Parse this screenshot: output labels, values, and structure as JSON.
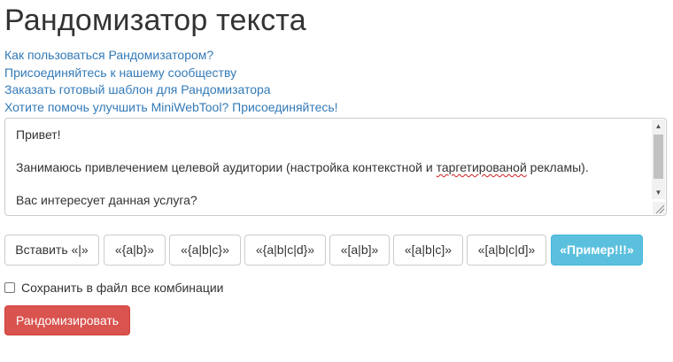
{
  "page": {
    "title": "Рандомизатор текста"
  },
  "links": [
    {
      "label": "Как пользоваться Рандомизатором?"
    },
    {
      "label": "Присоединяйтесь к нашему сообществу"
    },
    {
      "label": "Заказать готовый шаблон для Рандомизатора"
    },
    {
      "label": "Хотите помочь улучшить MiniWebTool? Присоединяйтесь!"
    }
  ],
  "editor": {
    "line1": "Привет!",
    "line2": "",
    "line3_before": "Занимаюсь привлечением целевой аудитории (настройка контекстной и ",
    "line3_misspelled": "таргетированой",
    "line3_after": " рекламы).",
    "line4": "",
    "line5": "Вас интересует данная услуга?"
  },
  "toolbar": {
    "buttons": [
      {
        "label": "Вставить «|»"
      },
      {
        "label": "«{a|b}»"
      },
      {
        "label": "«{a|b|c}»"
      },
      {
        "label": "«{a|b|c|d}»"
      },
      {
        "label": "«[a|b]»"
      },
      {
        "label": "«[a|b|c]»"
      },
      {
        "label": "«[a|b|c|d]»"
      },
      {
        "label": "«Пример!!!»"
      }
    ]
  },
  "options": {
    "save_combinations_label": "Сохранить в файл все комбинации",
    "save_combinations_checked": false
  },
  "actions": {
    "randomize_label": "Рандомизировать"
  },
  "colors": {
    "link": "#337ab7",
    "info": "#5bc0de",
    "danger": "#d9534f"
  }
}
